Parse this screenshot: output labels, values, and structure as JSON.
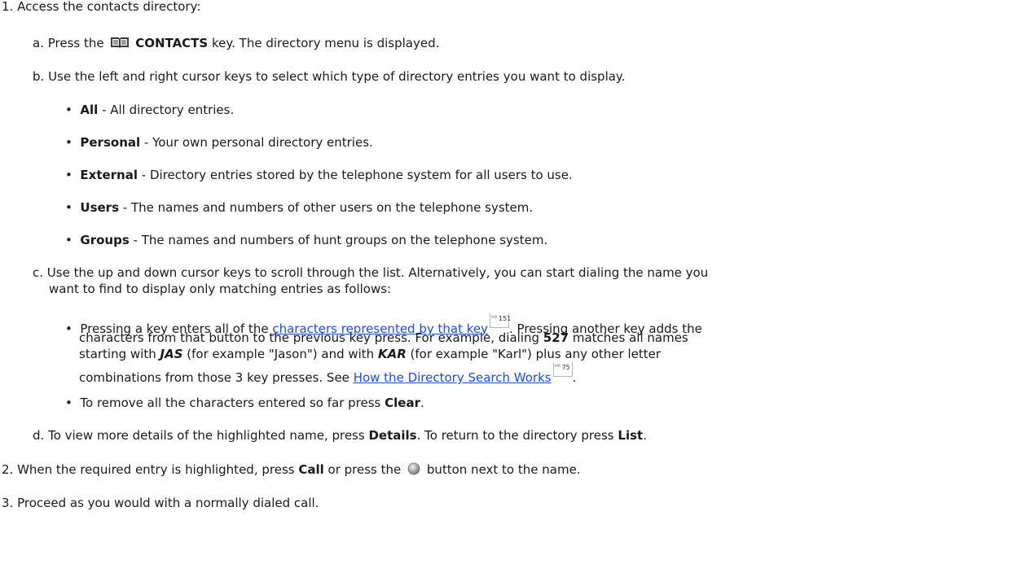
{
  "steps": {
    "s1": {
      "num": "1.",
      "text": "Access the contacts directory:"
    },
    "a": {
      "num": "a.",
      "pre": "Press the",
      "key": "CONTACTS",
      "post": "key. The directory menu is displayed."
    },
    "b": {
      "num": "b.",
      "text": "Use the left and right cursor keys to select which type of directory entries you want to display."
    },
    "types": [
      {
        "term": "All",
        "desc": " - All directory entries."
      },
      {
        "term": "Personal",
        "desc": " - Your own personal directory entries."
      },
      {
        "term": "External",
        "desc": " - Directory entries stored by the telephone system for all users to use."
      },
      {
        "term": "Users",
        "desc": " - The names and numbers of other users on the telephone system."
      },
      {
        "term": "Groups",
        "desc": " - The names and numbers of hunt groups on the telephone system."
      }
    ],
    "c": {
      "num": "c.",
      "line1": "Use the up and down cursor keys to scroll through the list. Alternatively, you can start dialing the name you",
      "line2": "want to find to display only matching entries as follows:"
    },
    "search": {
      "l1_pre": "Pressing a key enters all of the ",
      "l1_link": "characters represented by that key",
      "l1_ref": "151",
      "l1_post": ". Pressing another key adds the",
      "l2_pre": "characters from that button to the previous key press. For example, dialing ",
      "l2_num": "527",
      "l2_post": " matches all names",
      "l3_pre": "starting with ",
      "l3_jas": "JAS",
      "l3_mid": " (for example \"Jason\") and with ",
      "l3_kar": "KAR",
      "l3_post": " (for example \"Karl\") plus any other letter",
      "l4_pre": "combinations from those 3 key presses. See ",
      "l4_link": "How the Directory Search Works",
      "l4_ref": "75",
      "l4_post": "."
    },
    "clear": {
      "pre": "To remove all the characters entered so far press ",
      "key": "Clear",
      "post": "."
    },
    "d": {
      "num": "d.",
      "pre": "To view more details of the highlighted name, press ",
      "k1": "Details",
      "mid": ". To return to the directory press ",
      "k2": "List",
      "post": "."
    },
    "s2": {
      "num": "2.",
      "pre": "When the required entry is highlighted, press ",
      "key": "Call",
      "mid": " or press the",
      "post": "button next to the name."
    },
    "s3": {
      "num": "3.",
      "text": "Proceed as you would with a normally dialed call."
    }
  },
  "colors": {
    "link": "#1a4fd6",
    "text": "#1a1a1a"
  },
  "icons": {
    "contacts": "book-icon",
    "line_button": "round-button-icon",
    "ref": "page-reference-arrow-icon"
  }
}
